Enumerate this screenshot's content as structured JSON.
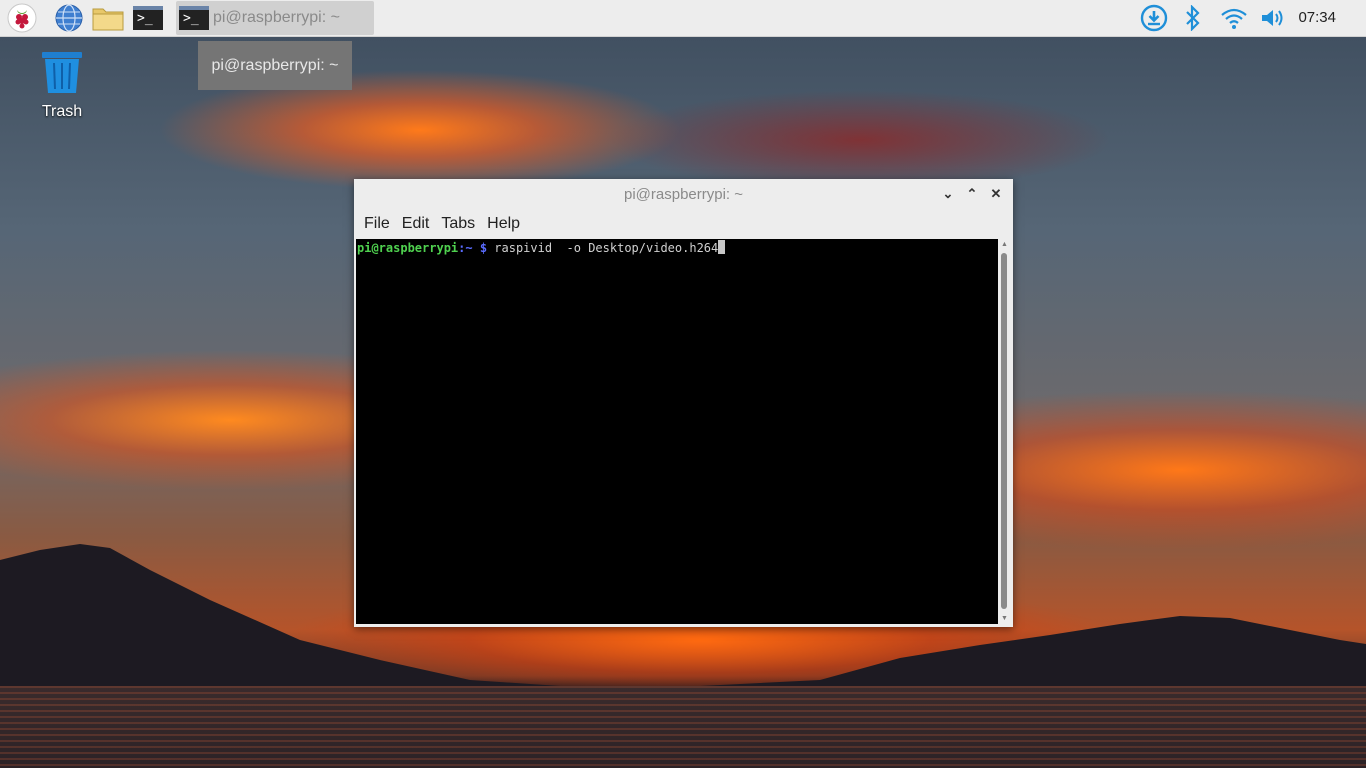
{
  "taskbar": {
    "task_label": "pi@raspberrypi: ~",
    "clock": "07:34",
    "icons": [
      "raspberry-menu-icon",
      "web-browser-icon",
      "file-manager-icon",
      "terminal-icon",
      "download-updates-icon",
      "bluetooth-icon",
      "wifi-icon",
      "volume-icon"
    ],
    "terminal_glyph": ">_"
  },
  "tooltip": {
    "text": "pi@raspberrypi: ~"
  },
  "desktop": {
    "trash_label": "Trash"
  },
  "window": {
    "title": "pi@raspberrypi: ~",
    "menu": {
      "file": "File",
      "edit": "Edit",
      "tabs": "Tabs",
      "help": "Help"
    },
    "controls": {
      "minimize": "⌄",
      "maximize": "⌃",
      "close": "✕"
    },
    "terminal": {
      "prompt_user": "pi@raspberrypi",
      "prompt_path": ":~ $",
      "command": " raspivid  -o Desktop/video.h264"
    }
  },
  "colors": {
    "accent": "#1f8fd8",
    "prompt_user": "#4fd14f",
    "prompt_path": "#5a6cff"
  }
}
